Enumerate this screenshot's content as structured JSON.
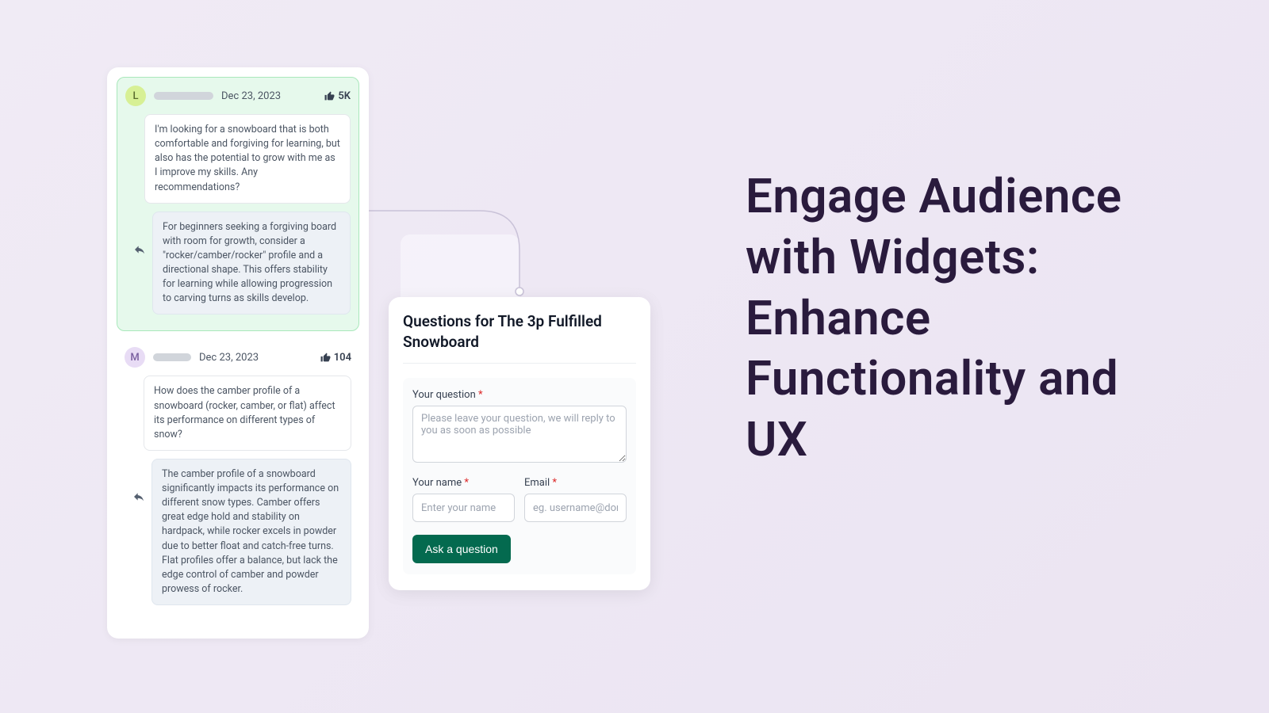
{
  "headline": "Engage Audience with Widgets: Enhance Functionality and UX",
  "qa": [
    {
      "avatar": "L",
      "date": "Dec 23, 2023",
      "likes": "5K",
      "question": "I'm looking for a snowboard that is both comfortable and forgiving for learning, but also has the potential to grow with me as I improve my skills. Any recommendations?",
      "answer": "For beginners seeking a forgiving board with room for growth, consider a \"rocker/camber/rocker\" profile and a directional shape. This offers stability for learning while allowing progression to carving turns as skills develop."
    },
    {
      "avatar": "M",
      "date": "Dec 23, 2023",
      "likes": "104",
      "question": "How does the camber profile of a snowboard (rocker, camber, or flat) affect its performance on different types of snow?",
      "answer": "The camber profile of a snowboard significantly impacts its performance on different snow types. Camber offers great edge hold and stability on hardpack, while rocker excels in powder due to better float and catch-free turns. Flat profiles offer a balance, but lack the edge control of camber and powder prowess of rocker."
    }
  ],
  "form": {
    "title": "Questions for The 3p Fulfilled Snowboard",
    "question_label": "Your question",
    "question_placeholder": "Please leave your question, we will reply to you as soon as possible",
    "name_label": "Your name",
    "name_placeholder": "Enter your name",
    "email_label": "Email",
    "email_placeholder": "eg. username@domain",
    "submit": "Ask a question"
  }
}
